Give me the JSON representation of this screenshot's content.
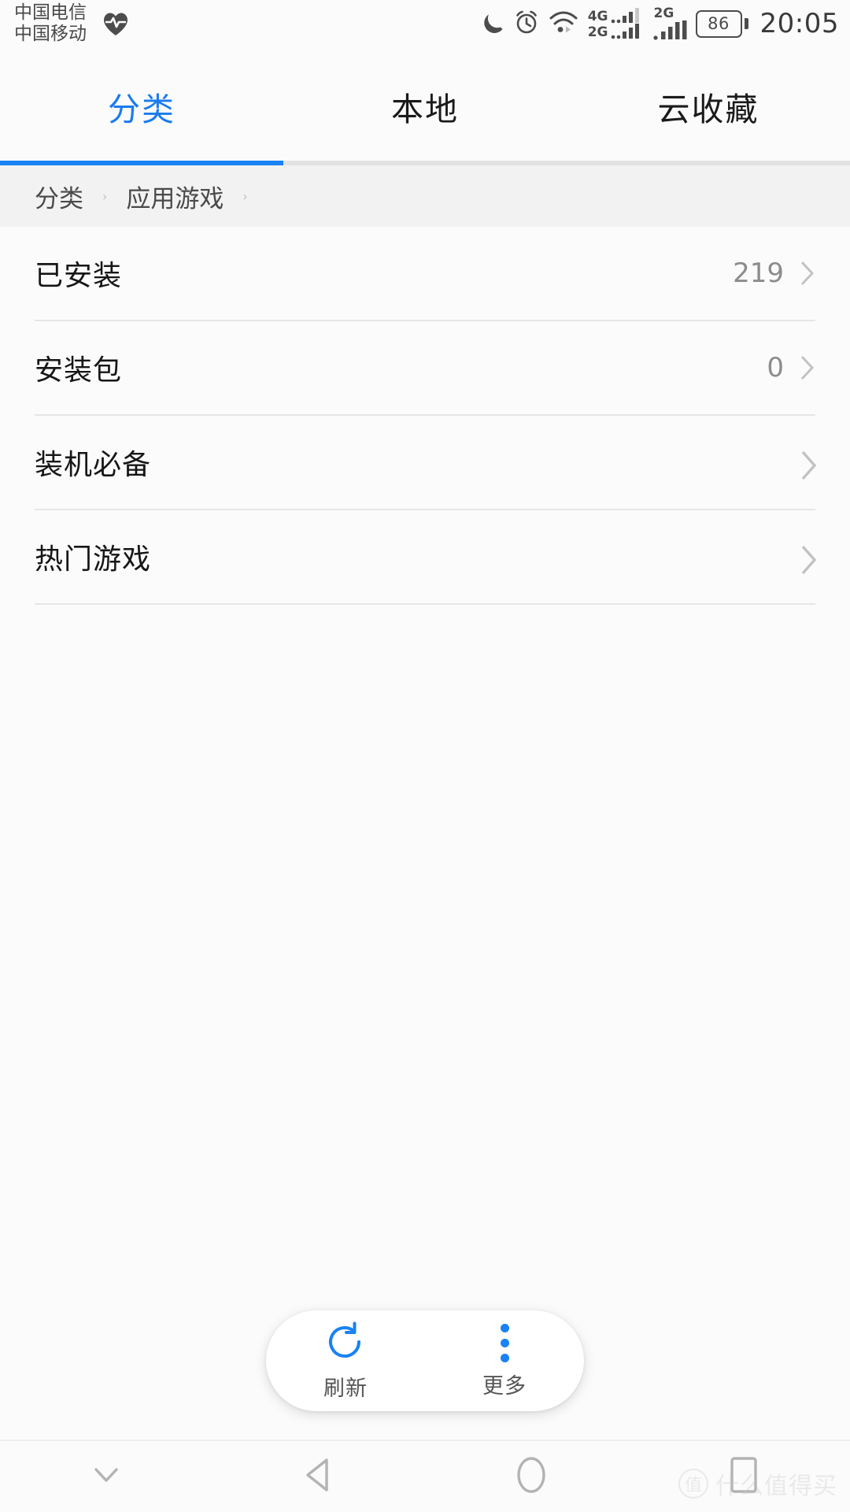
{
  "status_bar": {
    "carrier_primary": "中国电信",
    "carrier_secondary": "中国移动",
    "health_icon": "heart-rate-icon",
    "do_not_disturb_icon": "moon-icon",
    "alarm_icon": "alarm-clock-icon",
    "wifi_icon": "wifi-icon",
    "sim1_network_top": "4G",
    "sim1_network_bottom": "2G",
    "sim2_network": "2G",
    "battery_level": "86",
    "time": "20:05"
  },
  "tabs": [
    {
      "label": "分类",
      "active": true
    },
    {
      "label": "本地",
      "active": false
    },
    {
      "label": "云收藏",
      "active": false
    }
  ],
  "breadcrumb": {
    "items": [
      "分类",
      "应用游戏"
    ],
    "separator": "›"
  },
  "list": {
    "rows": [
      {
        "label": "已安装",
        "value": "219"
      },
      {
        "label": "安装包",
        "value": "0"
      },
      {
        "label": "装机必备",
        "value": ""
      },
      {
        "label": "热门游戏",
        "value": ""
      }
    ]
  },
  "toolbar": {
    "refresh_label": "刷新",
    "refresh_icon": "refresh-circular-arrow-icon",
    "more_label": "更多",
    "more_icon": "three-dots-vertical-icon"
  },
  "nav_bar": {
    "hide_icon": "chevron-down-icon",
    "back_icon": "back-triangle-icon",
    "home_icon": "home-circle-icon",
    "recents_icon": "recents-square-icon"
  },
  "watermark": {
    "badge": "值",
    "text": "什么值得买"
  },
  "colors": {
    "accent": "#1a82f2",
    "tab_active": "#1a7bf0",
    "text_primary": "#161616",
    "text_secondary": "#8c8c8c",
    "breadcrumb_bg": "#f2f2f2"
  }
}
